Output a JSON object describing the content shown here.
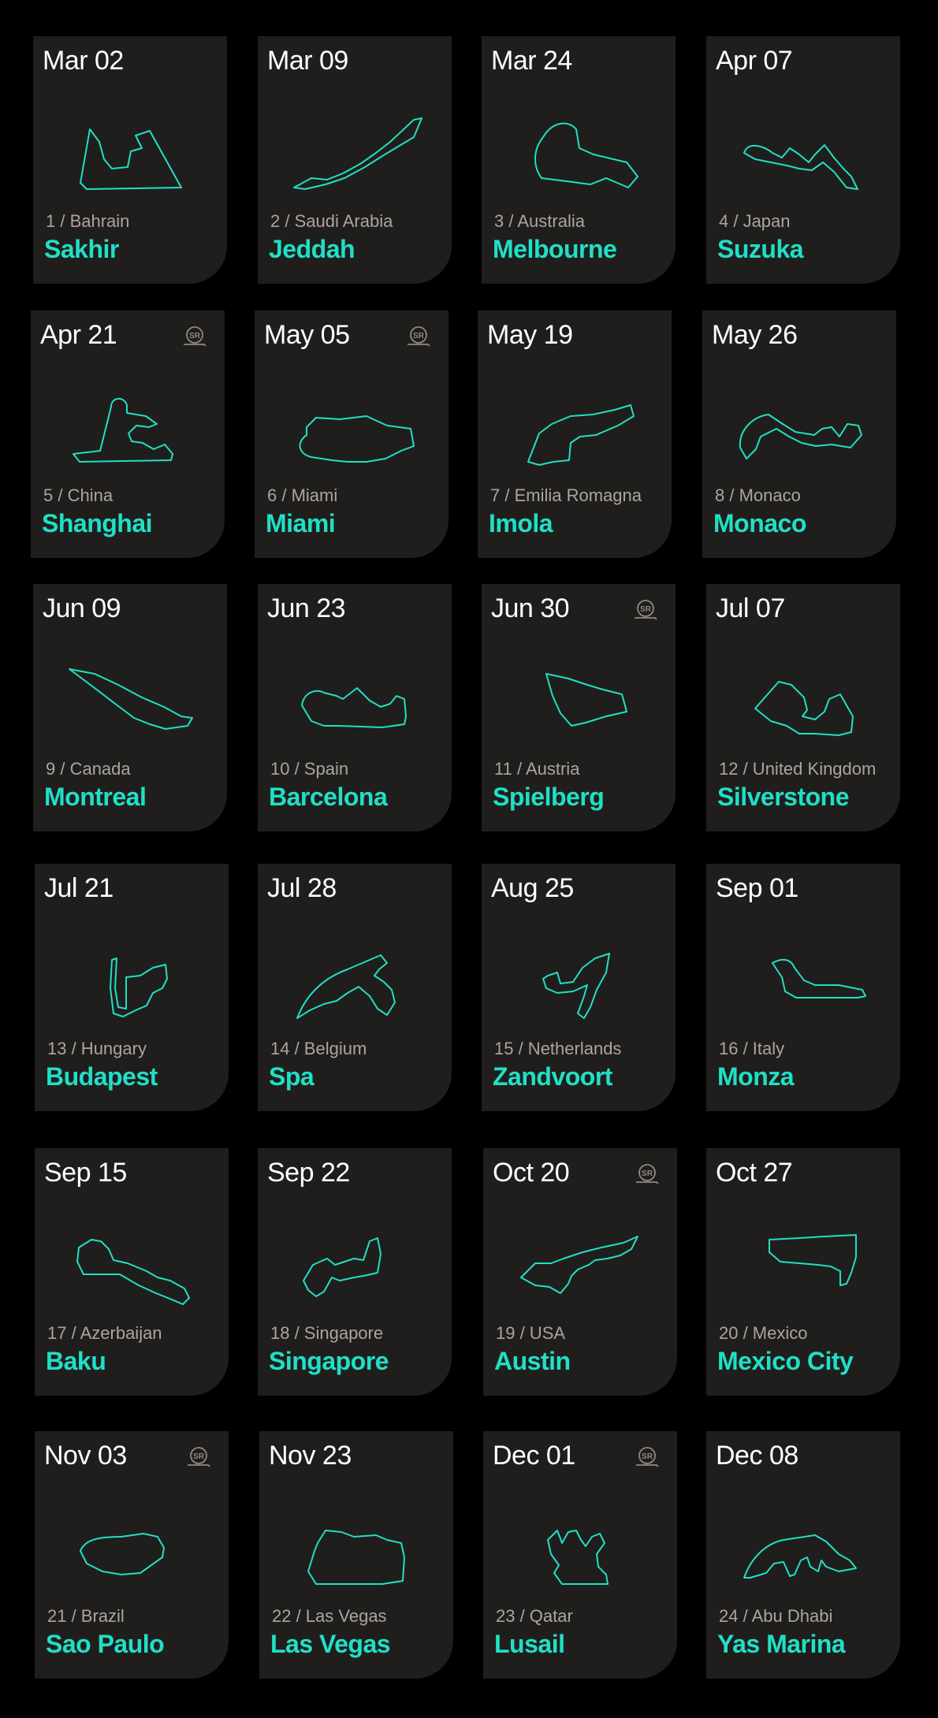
{
  "calendar": {
    "accent_color": "#1fe0c6",
    "card_color": "#201e1c",
    "sprint_badge_text": "SR",
    "races": [
      {
        "date": "Mar 02",
        "round_label": "1 / Bahrain",
        "city": "Sakhir",
        "sprint": false,
        "track_icon": "sakhir-track-icon"
      },
      {
        "date": "Mar 09",
        "round_label": "2 / Saudi Arabia",
        "city": "Jeddah",
        "sprint": false,
        "track_icon": "jeddah-track-icon"
      },
      {
        "date": "Mar 24",
        "round_label": "3 / Australia",
        "city": "Melbourne",
        "sprint": false,
        "track_icon": "melbourne-track-icon"
      },
      {
        "date": "Apr 07",
        "round_label": "4 / Japan",
        "city": "Suzuka",
        "sprint": false,
        "track_icon": "suzuka-track-icon"
      },
      {
        "date": "Apr 21",
        "round_label": "5 / China",
        "city": "Shanghai",
        "sprint": true,
        "track_icon": "shanghai-track-icon"
      },
      {
        "date": "May 05",
        "round_label": "6 / Miami",
        "city": "Miami",
        "sprint": true,
        "track_icon": "miami-track-icon"
      },
      {
        "date": "May 19",
        "round_label": "7 / Emilia Romagna",
        "city": "Imola",
        "sprint": false,
        "track_icon": "imola-track-icon"
      },
      {
        "date": "May 26",
        "round_label": "8 / Monaco",
        "city": "Monaco",
        "sprint": false,
        "track_icon": "monaco-track-icon"
      },
      {
        "date": "Jun 09",
        "round_label": "9 / Canada",
        "city": "Montreal",
        "sprint": false,
        "track_icon": "montreal-track-icon"
      },
      {
        "date": "Jun 23",
        "round_label": "10 / Spain",
        "city": "Barcelona",
        "sprint": false,
        "track_icon": "barcelona-track-icon"
      },
      {
        "date": "Jun 30",
        "round_label": "11 / Austria",
        "city": "Spielberg",
        "sprint": true,
        "track_icon": "spielberg-track-icon"
      },
      {
        "date": "Jul 07",
        "round_label": "12 / United Kingdom",
        "city": "Silverstone",
        "sprint": false,
        "track_icon": "silverstone-track-icon"
      },
      {
        "date": "Jul 21",
        "round_label": "13 / Hungary",
        "city": "Budapest",
        "sprint": false,
        "track_icon": "budapest-track-icon"
      },
      {
        "date": "Jul 28",
        "round_label": "14 / Belgium",
        "city": "Spa",
        "sprint": false,
        "track_icon": "spa-track-icon"
      },
      {
        "date": "Aug 25",
        "round_label": "15 / Netherlands",
        "city": "Zandvoort",
        "sprint": false,
        "track_icon": "zandvoort-track-icon"
      },
      {
        "date": "Sep 01",
        "round_label": "16 / Italy",
        "city": "Monza",
        "sprint": false,
        "track_icon": "monza-track-icon"
      },
      {
        "date": "Sep 15",
        "round_label": "17 / Azerbaijan",
        "city": "Baku",
        "sprint": false,
        "track_icon": "baku-track-icon"
      },
      {
        "date": "Sep 22",
        "round_label": "18 / Singapore",
        "city": "Singapore",
        "sprint": false,
        "track_icon": "singapore-track-icon"
      },
      {
        "date": "Oct 20",
        "round_label": "19 / USA",
        "city": "Austin",
        "sprint": true,
        "track_icon": "austin-track-icon"
      },
      {
        "date": "Oct 27",
        "round_label": "20 / Mexico",
        "city": "Mexico City",
        "sprint": false,
        "track_icon": "mexico-city-track-icon"
      },
      {
        "date": "Nov 03",
        "round_label": "21 / Brazil",
        "city": "Sao Paulo",
        "sprint": true,
        "track_icon": "sao-paulo-track-icon"
      },
      {
        "date": "Nov 23",
        "round_label": "22 / Las Vegas",
        "city": "Las Vegas",
        "sprint": false,
        "track_icon": "las-vegas-track-icon"
      },
      {
        "date": "Dec 01",
        "round_label": "23 / Qatar",
        "city": "Lusail",
        "sprint": true,
        "track_icon": "lusail-track-icon"
      },
      {
        "date": "Dec 08",
        "round_label": "24 / Abu Dhabi",
        "city": "Yas Marina",
        "sprint": false,
        "track_icon": "yas-marina-track-icon"
      }
    ]
  }
}
